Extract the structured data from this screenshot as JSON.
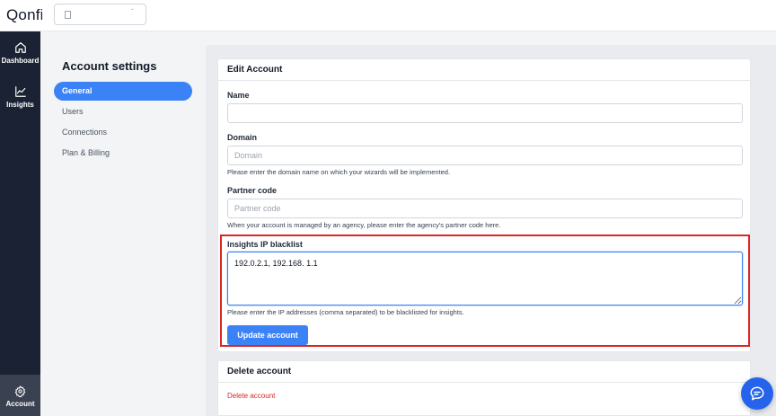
{
  "app": {
    "logo": "Qonfi"
  },
  "leftnav": {
    "items": [
      {
        "label": "Dashboard",
        "icon": "home-icon"
      },
      {
        "label": "Insights",
        "icon": "chart-icon"
      },
      {
        "label": "Account",
        "icon": "gear-icon"
      }
    ]
  },
  "settings": {
    "title": "Account settings",
    "items": [
      {
        "label": "General",
        "active": true
      },
      {
        "label": "Users"
      },
      {
        "label": "Connections"
      },
      {
        "label": "Plan & Billing"
      }
    ]
  },
  "edit_account": {
    "title": "Edit Account",
    "name": {
      "label": "Name",
      "value": "",
      "placeholder": ""
    },
    "domain": {
      "label": "Domain",
      "value": "",
      "placeholder": "Domain",
      "help": "Please enter the domain name on which your wizards will be implemented."
    },
    "partner_code": {
      "label": "Partner code",
      "value": "",
      "placeholder": "Partner code",
      "help": "When your account is managed by an agency, please enter the agency's partner code here."
    },
    "ip_blacklist": {
      "label": "Insights IP blacklist",
      "value": "192.0.2.1, 192.168. 1.1",
      "help": "Please enter the IP addresses (comma separated) to be blacklisted for insights."
    },
    "submit_label": "Update account"
  },
  "delete_account": {
    "title": "Delete account",
    "link_label": "Delete account"
  },
  "colors": {
    "accent": "#3b82f6",
    "nav_bg": "#1a2233",
    "danger": "#dc2626"
  }
}
